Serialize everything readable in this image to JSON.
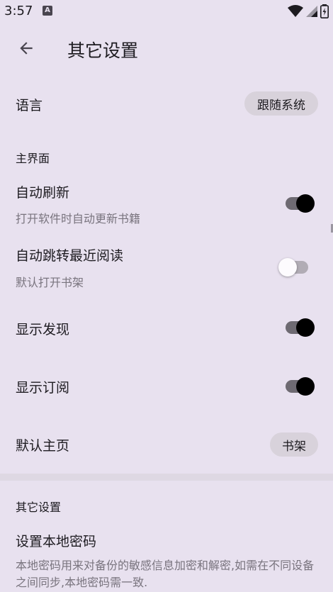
{
  "status": {
    "time": "3:57",
    "badge": "A"
  },
  "header": {
    "title": "其它设置"
  },
  "language": {
    "label": "语言",
    "value": "跟随系统"
  },
  "main_ui": {
    "section_title": "主界面",
    "auto_refresh": {
      "label": "自动刷新",
      "summary": "打开软件时自动更新书籍",
      "checked": true
    },
    "auto_jump": {
      "label": "自动跳转最近阅读",
      "summary": "默认打开书架",
      "checked": false
    },
    "show_discover": {
      "label": "显示发现",
      "checked": true
    },
    "show_rss": {
      "label": "显示订阅",
      "checked": true
    },
    "default_home": {
      "label": "默认主页",
      "value": "书架"
    }
  },
  "other": {
    "section_title": "其它设置",
    "local_password": {
      "label": "设置本地密码",
      "summary": "本地密码用来对备份的敏感信息加密和解密,如需在不同设备之间同步,本地密码需一致."
    }
  },
  "colors": {
    "background": "#e8e1ef",
    "chip": "#d8d2db",
    "switch_on_thumb": "#000000",
    "switch_on_track": "#6e6a72"
  }
}
